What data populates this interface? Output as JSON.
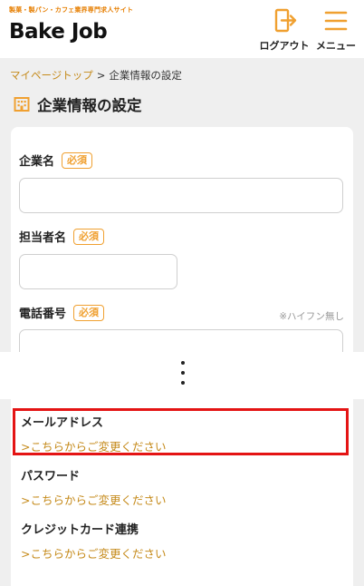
{
  "header": {
    "tagline": "製菓・製パン・カフェ業界専門求人サイト",
    "logo": "Bake Job",
    "logout_label": "ログアウト",
    "logout_icon": "logout-icon",
    "menu_label": "メニュー",
    "menu_icon": "hamburger-icon",
    "accent_color": "#f0a030"
  },
  "breadcrumb": {
    "home": "マイページトップ",
    "separator": ">",
    "current": "企業情報の設定"
  },
  "page": {
    "title": "企業情報の設定",
    "title_icon": "building-icon"
  },
  "form": {
    "required_label": "必須",
    "company_name": {
      "label": "企業名",
      "value": ""
    },
    "contact_person": {
      "label": "担当者名",
      "value": ""
    },
    "phone": {
      "label": "電話番号",
      "note": "※ハイフン無し",
      "value": ""
    }
  },
  "settings": {
    "email": {
      "label": "メールアドレス",
      "link": ">こちらからご変更ください"
    },
    "password": {
      "label": "パスワード",
      "link": ">こちらからご変更ください"
    },
    "credit_card": {
      "label": "クレジットカード連携",
      "link": ">こちらからご変更ください"
    }
  }
}
